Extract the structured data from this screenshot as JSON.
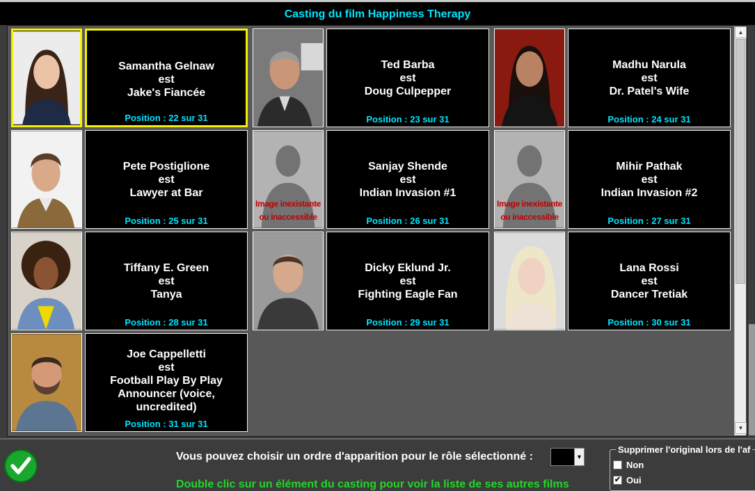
{
  "window": {
    "title": "Casting du film Happiness Therapy"
  },
  "cast": [
    {
      "actor": "Samantha Gelnaw",
      "verb": "est",
      "role": "Jake's Fiancée",
      "position": "Position : 22 sur 31",
      "selected": true,
      "photo": "woman-dark-hair"
    },
    {
      "actor": "Ted Barba",
      "verb": "est",
      "role": "Doug Culpepper",
      "position": "Position : 23 sur 31",
      "photo": "man-grey-hair"
    },
    {
      "actor": "Madhu Narula",
      "verb": "est",
      "role": "Dr. Patel's Wife",
      "position": "Position : 24 sur 31",
      "photo": "woman-red-backdrop"
    },
    {
      "actor": "Pete Postiglione",
      "verb": "est",
      "role": "Lawyer at Bar",
      "position": "Position : 25 sur 31",
      "photo": "man-brown-hair"
    },
    {
      "actor": "Sanjay Shende",
      "verb": "est",
      "role": "Indian Invasion #1",
      "position": "Position : 26 sur 31",
      "photo": "placeholder",
      "noimg": [
        "Image inexistante",
        "ou inaccessible"
      ]
    },
    {
      "actor": "Mihir Pathak",
      "verb": "est",
      "role": "Indian Invasion #2",
      "position": "Position : 27 sur 31",
      "photo": "placeholder",
      "noimg": [
        "Image inexistante",
        "ou inaccessible"
      ]
    },
    {
      "actor": "Tiffany E. Green",
      "verb": "est",
      "role": "Tanya",
      "position": "Position : 28 sur 31",
      "photo": "woman-curly-hair"
    },
    {
      "actor": "Dicky Eklund Jr.",
      "verb": "est",
      "role": "Fighting Eagle Fan",
      "position": "Position : 29 sur 31",
      "photo": "man-short-hair"
    },
    {
      "actor": "Lana Rossi",
      "verb": "est",
      "role": "Dancer Tretiak",
      "position": "Position : 30 sur 31",
      "photo": "woman-blonde"
    },
    {
      "actor": "Joe Cappelletti",
      "verb": "est",
      "role": "Football Play By Play Announcer (voice, uncredited)",
      "role_lines": [
        "Football Play By Play",
        "Announcer (voice,",
        "uncredited)"
      ],
      "position": "Position : 31 sur 31",
      "photo": "man-beard"
    }
  ],
  "footer": {
    "order_label": "Vous pouvez choisir un ordre d'apparition pour le rôle sélectionné :",
    "order_value": "",
    "hint": "Double clic sur un élément du casting pour voir la liste de ses autres films",
    "group_label": "Supprimer l'original lors de l'af",
    "option_non": "Non",
    "option_oui": "Oui",
    "option_oui_checked": true
  },
  "colors": {
    "accent": "#00e5ff",
    "selection": "#f4f000",
    "hint": "#22d828",
    "ok": "#19a72d"
  }
}
